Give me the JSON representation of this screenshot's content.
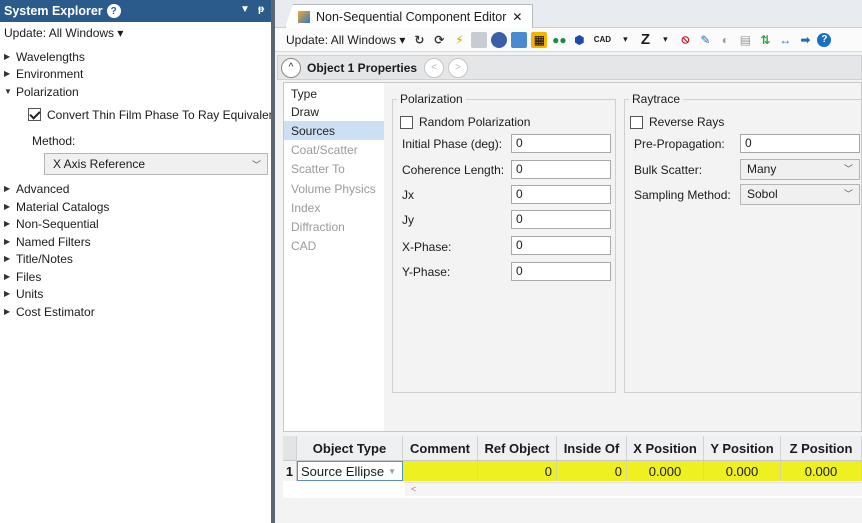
{
  "system_explorer": {
    "title": "System Explorer",
    "help_glyph": "?",
    "pin_glyph": "ᵽ",
    "update_label": "Update: All Windows ▾",
    "items": {
      "wavelengths": "Wavelengths",
      "environment": "Environment",
      "polarization": "Polarization",
      "convert_checkbox": "Convert Thin Film Phase To Ray Equivalent",
      "method_label": "Method:",
      "method_value": "X Axis Reference",
      "advanced": "Advanced",
      "material_catalogs": "Material Catalogs",
      "non_sequential": "Non-Sequential",
      "named_filters": "Named Filters",
      "title_notes": "Title/Notes",
      "files": "Files",
      "units": "Units",
      "cost_estimator": "Cost Estimator"
    }
  },
  "editor": {
    "tab_title": "Non-Sequential Component Editor",
    "tab_close": "✕",
    "toolbar": {
      "update_label": "Update: All Windows ▾",
      "cad_label": "CAD",
      "z_label": "Z"
    },
    "object_header": {
      "title": "Object  1 Properties",
      "collapse_glyph": "^",
      "prev_glyph": "<",
      "next_glyph": ">"
    },
    "nav": [
      "Type",
      "Draw",
      "Sources",
      "Coat/Scatter",
      "Scatter To",
      "Volume Physics",
      "Index",
      "Diffraction",
      "CAD"
    ],
    "polarization": {
      "group_label": "Polarization",
      "random_label": "Random Polarization",
      "initial_phase_label": "Initial Phase (deg):",
      "initial_phase_value": "0",
      "coherence_label": "Coherence Length:",
      "coherence_value": "0",
      "jx_label": "Jx",
      "jx_value": "0",
      "jy_label": "Jy",
      "jy_value": "0",
      "xphase_label": "X-Phase:",
      "xphase_value": "0",
      "yphase_label": "Y-Phase:",
      "yphase_value": "0"
    },
    "raytrace": {
      "group_label": "Raytrace",
      "reverse_label": "Reverse Rays",
      "preprop_label": "Pre-Propagation:",
      "preprop_value": "0",
      "bulk_label": "Bulk Scatter:",
      "bulk_value": "Many",
      "sampling_label": "Sampling Method:",
      "sampling_value": "Sobol"
    },
    "grid": {
      "headers": [
        "Object Type",
        "Comment",
        "Ref Object",
        "Inside Of",
        "X Position",
        "Y Position",
        "Z Position"
      ],
      "row": {
        "index": "1",
        "object_type": "Source Ellipse",
        "comment": "",
        "ref_object": "0",
        "inside_of": "0",
        "x_position": "0.000",
        "y_position": "0.000",
        "z_position": "0.000"
      },
      "scroll_left_glyph": "<"
    }
  }
}
